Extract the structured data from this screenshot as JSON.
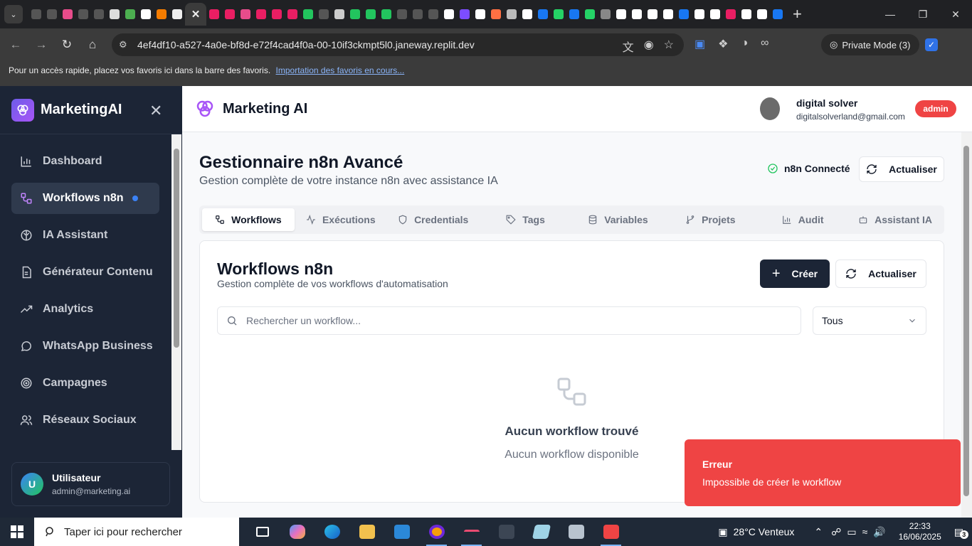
{
  "browser": {
    "url": "4ef4df10-a527-4a0e-bf8d-e72f4cad4f0a-00-10if3ckmpt5l0.janeway.replit.dev",
    "private_mode": "Private Mode (3)",
    "bookmarks_text": "Pour un accès rapide, placez vos favoris ici dans la barre des favoris.",
    "bookmarks_link": "Importation des favoris en cours...",
    "tab_favicon_colors": [
      "#555",
      "#555",
      "#e74c8b",
      "#555",
      "#555",
      "#ddd",
      "#4caf50",
      "#fff",
      "#f57c00",
      "#eee",
      "#e91e63",
      "#e91e63",
      "#e74c8b",
      "#e91e63",
      "#e91e63",
      "#e91e63",
      "#22c55e",
      "#555",
      "#ccc",
      "#22c55e",
      "#22c55e",
      "#22c55e",
      "#555",
      "#555",
      "#555",
      "#fff",
      "#7c4dff",
      "#fff",
      "#ff7043",
      "#bbb",
      "#fff",
      "#1877f2",
      "#25d366",
      "#1877f2",
      "#25d366",
      "#888",
      "#fff",
      "#fff",
      "#fff",
      "#fff",
      "#1877f2",
      "#fff",
      "#fff",
      "#e91e63",
      "#fff",
      "#fff",
      "#1877f2"
    ]
  },
  "sidebar": {
    "brand": "MarketingAI",
    "items": [
      {
        "label": "Dashboard"
      },
      {
        "label": "Workflows n8n"
      },
      {
        "label": "IA Assistant"
      },
      {
        "label": "Générateur Contenu"
      },
      {
        "label": "Analytics"
      },
      {
        "label": "WhatsApp Business"
      },
      {
        "label": "Campagnes"
      },
      {
        "label": "Réseaux Sociaux"
      }
    ],
    "user": {
      "initial": "U",
      "name": "Utilisateur",
      "email": "admin@marketing.ai"
    }
  },
  "header": {
    "title": "Marketing AI",
    "profile_name": "digital solver",
    "profile_email": "digitalsolverland@gmail.com",
    "role_badge": "admin"
  },
  "page": {
    "title": "Gestionnaire n8n Avancé",
    "subtitle": "Gestion complète de votre instance n8n avec assistance IA",
    "status": "n8n Connecté",
    "refresh": "Actualiser"
  },
  "tabs": [
    {
      "label": "Workflows"
    },
    {
      "label": "Exécutions"
    },
    {
      "label": "Credentials"
    },
    {
      "label": "Tags"
    },
    {
      "label": "Variables"
    },
    {
      "label": "Projets"
    },
    {
      "label": "Audit"
    },
    {
      "label": "Assistant IA"
    }
  ],
  "card": {
    "title": "Workflows n8n",
    "subtitle": "Gestion complète de vos workflows d'automatisation",
    "create": "Créer",
    "refresh": "Actualiser",
    "search_placeholder": "Rechercher un workflow...",
    "filter": "Tous",
    "empty_title": "Aucun workflow trouvé",
    "empty_subtitle": "Aucun workflow disponible"
  },
  "toast": {
    "title": "Erreur",
    "message": "Impossible de créer le workflow"
  },
  "taskbar": {
    "search": "Taper ici pour rechercher",
    "weather": "28°C  Venteux",
    "time": "22:33",
    "date": "16/06/2025",
    "notifications": "3"
  },
  "colors": {
    "accent": "#3b82f6",
    "danger": "#ef4444",
    "sidebar": "#1c2536",
    "success": "#22c55e"
  }
}
